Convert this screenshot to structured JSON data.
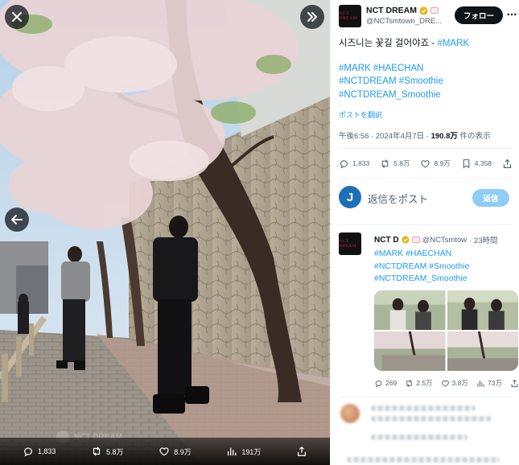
{
  "photo_toolbar": {
    "replies": "1,833",
    "reposts": "5.8万",
    "likes": "8.9万",
    "views": "191万",
    "ghost_name": "NCT DREAM"
  },
  "tweet": {
    "display_name": "NCT DREAM",
    "handle": "@NCTsmtown_DRE...",
    "follow_label": "フォロー",
    "text_line1": "시즈니는 꽃길 걸어야죠 - ",
    "text_mention": "#MARK",
    "hashtag_line1": "#MARK #HAECHAN",
    "hashtag_line2": "#NCTDREAM #Smoothie",
    "hashtag_line3": "#NCTDREAM_Smoothie",
    "translate_label": "ポストを翻訳",
    "time": "午後6:56 · 2024年4月7日 · ",
    "views_count": "190.8万",
    "views_suffix": " 件の表示",
    "stats": {
      "replies": "1,833",
      "reposts": "5.8万",
      "likes": "8.9万",
      "bookmarks": "4,358"
    }
  },
  "reply_box": {
    "avatar_letter": "J",
    "placeholder": "返信をポスト",
    "button_label": "返信"
  },
  "quoted_post": {
    "display_name": "NCT D",
    "handle": "@NCTsmtow",
    "time": "· 23時間",
    "hashtag_line1": "#MARK #HAECHAN",
    "hashtag_line2": "#NCTDREAM #Smoothie",
    "hashtag_line3": "#NCTDREAM_Smoothie",
    "stats": {
      "replies": "269",
      "reposts": "2.5万",
      "likes": "3.8万",
      "views": "73万"
    }
  },
  "colors": {
    "accent": "#1d9bf0",
    "text": "#0f1419",
    "muted": "#536471",
    "reply_button": "#8ecdf8"
  }
}
